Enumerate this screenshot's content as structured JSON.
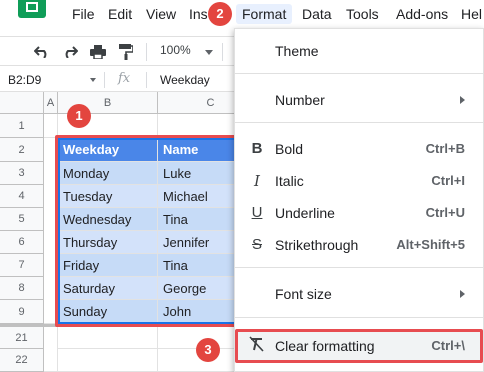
{
  "menubar": {
    "items": [
      "File",
      "Edit",
      "View",
      "Ins",
      "Format",
      "Data",
      "Tools",
      "Add-ons",
      "Hel"
    ]
  },
  "toolbar": {
    "zoom": "100%"
  },
  "formula_bar": {
    "name_box": "B2:D9",
    "fx": "fx",
    "value": "Weekday"
  },
  "sheet": {
    "columns": [
      "A",
      "B",
      "C"
    ],
    "rows": [
      "1",
      "2",
      "3",
      "4",
      "5",
      "6",
      "7",
      "8",
      "9",
      "21",
      "22"
    ],
    "header": [
      "Weekday",
      "Name"
    ],
    "data": [
      [
        "Monday",
        "Luke"
      ],
      [
        "Tuesday",
        "Michael"
      ],
      [
        "Wednesday",
        "Tina"
      ],
      [
        "Thursday",
        "Jennifer"
      ],
      [
        "Friday",
        "Tina"
      ],
      [
        "Saturday",
        "George"
      ],
      [
        "Sunday",
        "John"
      ]
    ]
  },
  "format_menu": {
    "theme": "Theme",
    "number": "Number",
    "bold": {
      "label": "Bold",
      "shortcut": "Ctrl+B",
      "icon": "B"
    },
    "italic": {
      "label": "Italic",
      "shortcut": "Ctrl+I",
      "icon": "I"
    },
    "underline": {
      "label": "Underline",
      "shortcut": "Ctrl+U",
      "icon": "U"
    },
    "strikethrough": {
      "label": "Strikethrough",
      "shortcut": "Alt+Shift+5",
      "icon": "S"
    },
    "font_size": "Font size",
    "clear_formatting": {
      "label": "Clear formatting",
      "shortcut": "Ctrl+\\",
      "icon": "clear-formatting-icon"
    }
  },
  "callouts": [
    "1",
    "2",
    "3"
  ],
  "colors": {
    "header_fill": "#4a86e8",
    "band_fill": "#e8f0fe",
    "selection": "#1a73e8",
    "callout_red": "#e3453f",
    "sheets_green": "#0f9d58"
  }
}
